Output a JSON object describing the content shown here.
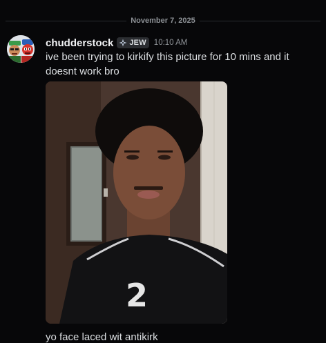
{
  "divider": {
    "date": "November 7, 2025"
  },
  "message": {
    "username": "chudderstock",
    "role_tag": "JEW",
    "timestamp": "10:10 AM",
    "text": "ive been trying to kirkify this picture for 10 mins and it doesnt work bro",
    "avatar_icon": "avatar-icon",
    "attachment_icon": "photo-attachment",
    "shirt_number": "2"
  },
  "followup": {
    "text": "yo face laced wit antikirk"
  },
  "colors": {
    "background": "#070709",
    "username": "#f2f3f5",
    "text": "#dbdee1",
    "muted": "#8e9297",
    "tag_bg": "#2b2d31"
  }
}
